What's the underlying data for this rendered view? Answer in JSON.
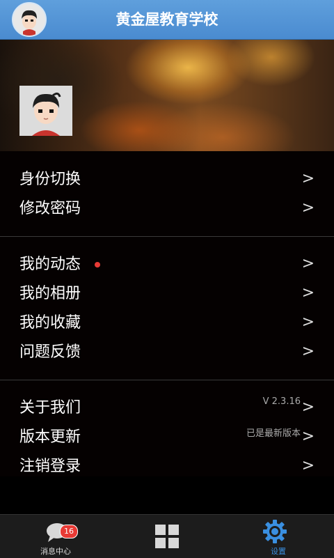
{
  "header": {
    "title": "黄金屋教育学校"
  },
  "menu_group_1": [
    {
      "label": "身份切换",
      "chevron": ">"
    },
    {
      "label": "修改密码",
      "chevron": ">"
    }
  ],
  "menu_group_2": [
    {
      "label": "我的动态",
      "chevron": ">",
      "has_dot": true
    },
    {
      "label": "我的相册",
      "chevron": ">"
    },
    {
      "label": "我的收藏",
      "chevron": ">"
    },
    {
      "label": "问题反馈",
      "chevron": ">"
    }
  ],
  "menu_group_3": [
    {
      "label": "关于我们",
      "chevron": ">",
      "info": "V 2.3.16"
    },
    {
      "label": "版本更新",
      "chevron": ">",
      "info": "已是最新版本"
    },
    {
      "label": "注销登录",
      "chevron": ">"
    }
  ],
  "bottom_nav": {
    "messages": {
      "label": "消息中心",
      "badge": "16",
      "icon": "chat-bubble-icon"
    },
    "apps": {
      "icon": "grid-icon"
    },
    "settings": {
      "label": "设置",
      "icon": "gear-icon"
    }
  },
  "colors": {
    "header": "#4a8bd0",
    "accent": "#3a8fe0",
    "badge": "#e83a35"
  }
}
